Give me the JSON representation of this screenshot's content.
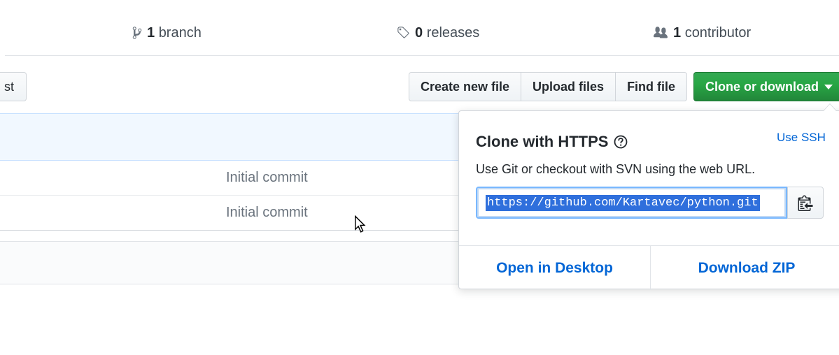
{
  "summary": {
    "branch_count": "1",
    "branch_label": "branch",
    "releases_count": "0",
    "releases_label": "releases",
    "contributor_count": "1",
    "contributor_label": "contributor"
  },
  "toolbar": {
    "partial_left_button": "st",
    "create_new_file": "Create new file",
    "upload_files": "Upload files",
    "find_file": "Find file",
    "clone_or_download": "Clone or download"
  },
  "files": {
    "rows": [
      {
        "commit_message": "Initial commit"
      },
      {
        "commit_message": "Initial commit"
      }
    ]
  },
  "clone_dropdown": {
    "title": "Clone with HTTPS",
    "use_ssh": "Use SSH",
    "description": "Use Git or checkout with SVN using the web URL.",
    "url": "https://github.com/Kartavec/python.git",
    "open_in_desktop": "Open in Desktop",
    "download_zip": "Download ZIP"
  },
  "colors": {
    "accent_blue": "#0366d6",
    "clone_green": "#28a745",
    "selection_blue": "#2f6fdc"
  },
  "icons": [
    "branch-icon",
    "tag-icon",
    "people-icon",
    "question-icon",
    "clipboard-icon",
    "caret-down-icon",
    "mouse-cursor-icon"
  ]
}
